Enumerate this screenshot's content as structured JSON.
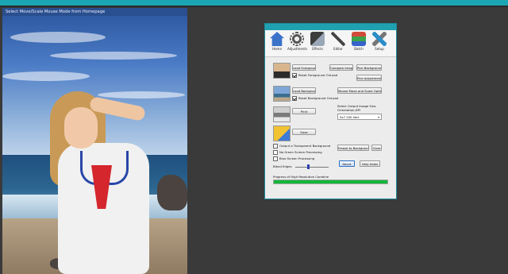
{
  "image_window": {
    "title": "Select Move/Scale Mouse Mode from Homepage"
  },
  "app": {
    "title": "",
    "toolbar": [
      {
        "label": "Home",
        "icon": "home-icon",
        "color": "#3b73c9"
      },
      {
        "label": "Adjustments",
        "icon": "gear-icon",
        "color": "#555555"
      },
      {
        "label": "Effects",
        "icon": "effects-icon",
        "color": "#3d3d3d"
      },
      {
        "label": "Editor",
        "icon": "pen-icon",
        "color": "#444444"
      },
      {
        "label": "Batch",
        "icon": "batch-icon",
        "color": "#d24b3a"
      },
      {
        "label": "Setup",
        "icon": "tools-icon",
        "color": "#2a8fc7"
      }
    ],
    "buttons": {
      "load_foreground": "Load Foreground",
      "compare_images": "Compare Images",
      "pick_background": "Pick Background",
      "pick_adjustment": "Pick Adjustment",
      "load_background": "Load Background",
      "mouse_move_scale": "Mouse Move and Scale Options",
      "print": "Print",
      "save": "Save",
      "freeze_background": "Freeze to Background",
      "clear": "Clear",
      "about": "About",
      "help_index": "Help Index"
    },
    "checkboxes": {
      "reset_foreground": "Reset Foreground OnLoad",
      "reset_background": "Reset Background OnLoad",
      "output_transparent": "Output a Transparent Background",
      "no_green_screen": "No Green Screen Processing",
      "blue_screen": "Blue Screen Processing"
    },
    "labels": {
      "select_output_size": "Select Output Image Size,",
      "orientation_dpi": "Orientation,DPI",
      "blend_edges": "Blend Edges",
      "progress_label": "Progress of High Resolution Combine"
    },
    "output_size_value": "5x7 200 Vert",
    "blend_edges_level": 0.4,
    "progress_fraction": 1.0,
    "accent": "#20a1b1",
    "progress_color": "#14b63b"
  }
}
